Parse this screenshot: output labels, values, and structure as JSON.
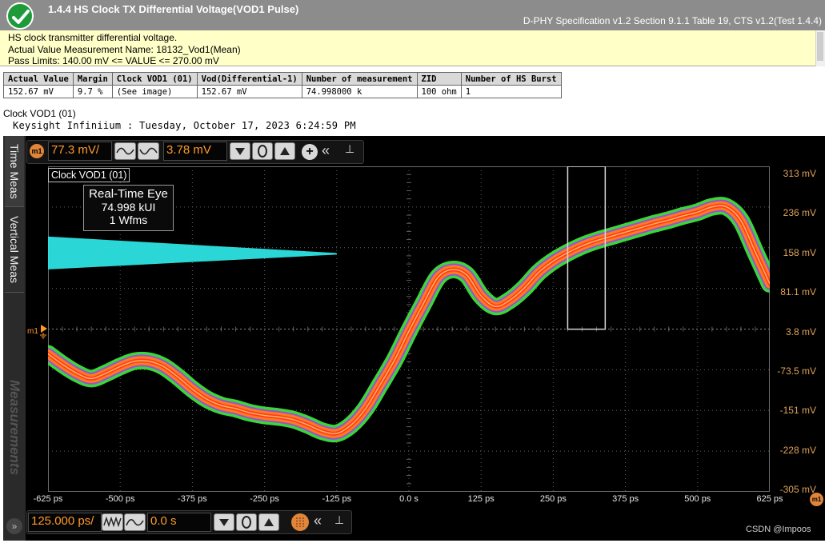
{
  "header": {
    "title": "1.4.4 HS Clock TX Differential Voltage(VOD1 Pulse)",
    "spec": "D-PHY Specification v1.2 Section 9.1.1 Table 19, CTS v1.2(Test 1.4.4)",
    "status_color": "#1e9a3a"
  },
  "description": {
    "line1": "HS clock transmitter differential voltage.",
    "line2": "Actual Value Measurement Name: 18132_Vod1(Mean)",
    "line3": "Pass Limits: 140.00 mV <= VALUE <= 270.00 mV"
  },
  "table": {
    "headers": [
      "Actual Value",
      "Margin",
      "Clock VOD1 (01)",
      "Vod(Differential-1)",
      "Number of measurement",
      "ZID",
      "Number of HS Burst"
    ],
    "row": [
      "152.67 mV",
      "9.7 %",
      "(See image)",
      "152.67 mV",
      "74.998000 k",
      "100 ohm",
      "1"
    ]
  },
  "image": {
    "caption": "Clock VOD1 (01)",
    "timestamp": "Keysight Infiniium : Tuesday, October 17, 2023 6:24:59 PM"
  },
  "scope": {
    "tabs": {
      "time": "Time Meas",
      "vertical": "Vertical Meas",
      "measurements": "Measurements"
    },
    "marker_label": "m1",
    "top_bar": {
      "scale": "77.3 mV/",
      "offset": "3.78 mV"
    },
    "bottom_bar": {
      "scale": "125.000 ps/",
      "offset": "0.0 s"
    },
    "trace_label": "Clock VOD1 (01)",
    "info": {
      "line1": "Real-Time Eye",
      "line2": "74.998 kUI",
      "line3": "1 Wfms"
    },
    "watermark": "CSDN @Impoos",
    "colors": {
      "axis_y": "#e0a35a",
      "axis_x": "#e6e6e6",
      "grid": "#5e5e5e",
      "trace_edge": "#3bd63b",
      "trace_mid": "#9a4fd8",
      "trace_inner": "#ff7a1a",
      "trace_core": "#ff3b2b",
      "cyan": "#2fe8e8",
      "status_pass": "#1e9a3a",
      "accent_orange": "#ff9a2a"
    }
  },
  "chart_data": {
    "type": "line",
    "title": "",
    "xlabel": "",
    "ylabel": "",
    "xlim": [
      -625,
      625
    ],
    "ylim": [
      -305,
      313
    ],
    "x_ticks": [
      "-625 ps",
      "-500 ps",
      "-375 ps",
      "-250 ps",
      "-125 ps",
      "0.0 s",
      "125 ps",
      "250 ps",
      "375 ps",
      "500 ps",
      "625 ps"
    ],
    "y_ticks": [
      "313 mV",
      "236 mV",
      "158 mV",
      "81.1 mV",
      "3.8 mV",
      "-73.5 mV",
      "-151 mV",
      "-228 mV",
      "-305 mV"
    ],
    "series": [
      {
        "x": [
          -625,
          -600,
          -575,
          -550,
          -525,
          -500,
          -475,
          -450,
          -425,
          -400,
          -375,
          -350,
          -325,
          -300,
          -275,
          -250,
          -225,
          -200,
          -175,
          -150,
          -125,
          -100,
          -75,
          -50,
          -25,
          0,
          25,
          50,
          75,
          100,
          125,
          150,
          175,
          200,
          225,
          250,
          275,
          300,
          325,
          350,
          375,
          400,
          425,
          450,
          475,
          500,
          525,
          550,
          575,
          600,
          625
        ],
        "y": [
          -43,
          -63,
          -80,
          -90,
          -80,
          -67,
          -57,
          -57,
          -67,
          -87,
          -110,
          -129,
          -141,
          -147,
          -155,
          -160,
          -163,
          -168,
          -178,
          -190,
          -194,
          -178,
          -147,
          -102,
          -55,
          0,
          52,
          102,
          117,
          107,
          67,
          47,
          59,
          82,
          112,
          133,
          149,
          162,
          172,
          180,
          188,
          196,
          204,
          211,
          219,
          226,
          236,
          236,
          210,
          150,
          90
        ]
      }
    ],
    "cyan_profile": {
      "x": [
        -625,
        -125
      ],
      "y": [
        140,
        160
      ]
    },
    "measurement_box": {
      "x": [
        275,
        340
      ],
      "y": [
        3.8,
        313
      ]
    },
    "grid": true
  }
}
